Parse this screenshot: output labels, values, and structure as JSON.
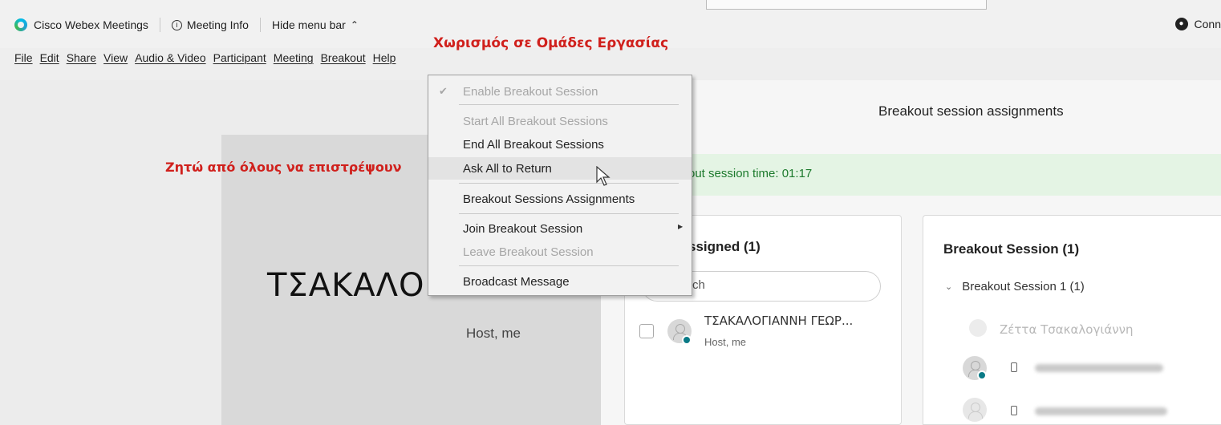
{
  "app": {
    "title": "Cisco Webex Meetings",
    "meeting_info": "Meeting Info",
    "hide_menu_bar": "Hide menu bar",
    "connect": "Conn"
  },
  "menubar": {
    "items": [
      "File",
      "Edit",
      "Share",
      "View",
      "Audio & Video",
      "Participant",
      "Meeting",
      "Breakout",
      "Help"
    ]
  },
  "annotations": {
    "top": "Χωρισμός σε Ομάδες Εργασίας",
    "left": "Ζητώ από όλους να επιστρέψουν"
  },
  "breakout_menu": {
    "enable": "Enable Breakout Session",
    "start_all": "Start All Breakout Sessions",
    "end_all": "End All Breakout Sessions",
    "ask_return": "Ask All to Return",
    "assignments": "Breakout Sessions Assignments",
    "join": "Join Breakout Session",
    "leave": "Leave Breakout Session",
    "broadcast": "Broadcast Message"
  },
  "video": {
    "name": "ΤΣΑΚΑΛΟΓΙΑΝΝΗ",
    "role": "Host, me"
  },
  "panel": {
    "title": "Breakout session assignments",
    "timer_text": "out session time: 01:17",
    "unassigned_title": "ssigned (1)",
    "search_placeholder": "rch",
    "participant_name": "ΤΣΑΚΑΛΟΓΙΑΝΝΗ ΓΕΩΡ...",
    "participant_role": "Host, me",
    "sessions_title": "Breakout Session  (1)",
    "session_1": "Breakout Session 1 (1)",
    "session_member_faded": "Ζέττα Τσακαλογιάννη"
  },
  "colors": {
    "annotation": "#d0201c",
    "timer_green": "#1d7a2d",
    "timer_bg": "#e4f4e4",
    "status_teal": "#0a7a86"
  }
}
